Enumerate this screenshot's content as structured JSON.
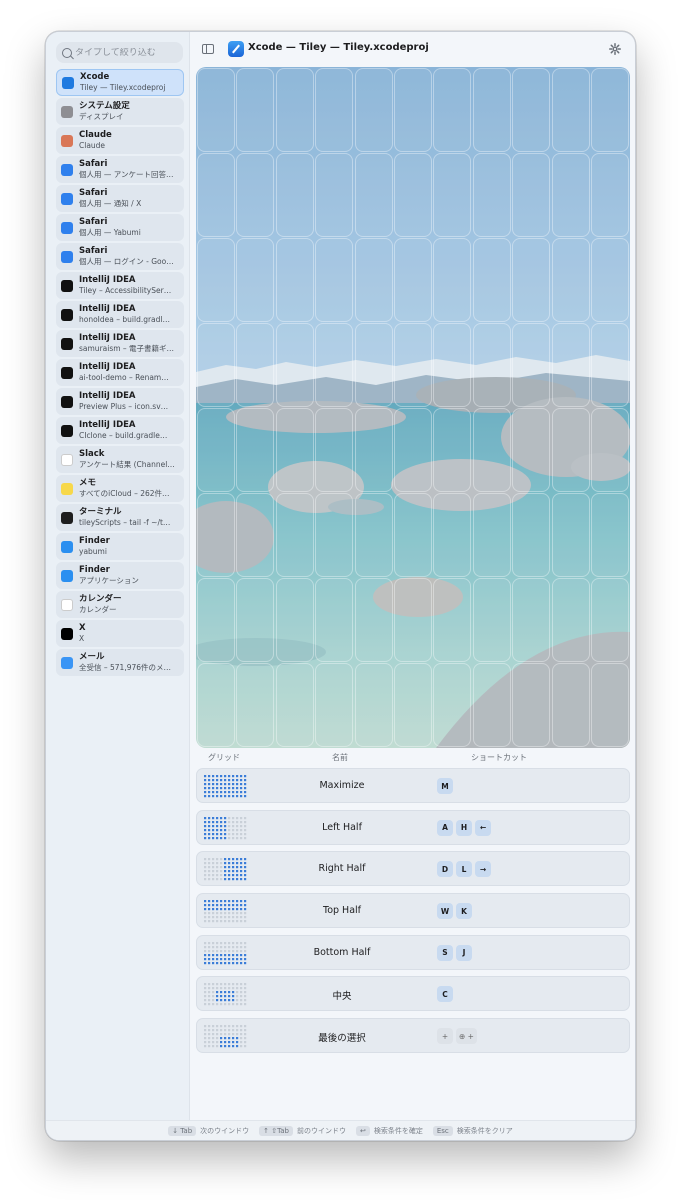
{
  "window": {
    "title": "Xcode — Tiley — Tiley.xcodeproj"
  },
  "search": {
    "placeholder": "タイプして絞り込む"
  },
  "apps": [
    {
      "name": "Xcode",
      "sub": "Tiley — Tiley.xcodeproj",
      "icon": "xcode-icon",
      "color": "#1f7ae0",
      "selected": true
    },
    {
      "name": "システム設定",
      "sub": "ディスプレイ",
      "icon": "settings-icon",
      "color": "#8e8e93"
    },
    {
      "name": "Claude",
      "sub": "Claude",
      "icon": "claude-icon",
      "color": "#d97757"
    },
    {
      "name": "Safari",
      "sub": "個人用 — アンケート回答…",
      "icon": "safari-icon",
      "color": "#2f80ed"
    },
    {
      "name": "Safari",
      "sub": "個人用 — 通知 / X",
      "icon": "safari-icon",
      "color": "#2f80ed"
    },
    {
      "name": "Safari",
      "sub": "個人用 — Yabumi",
      "icon": "safari-icon",
      "color": "#2f80ed"
    },
    {
      "name": "Safari",
      "sub": "個人用 — ログイン - Goo…",
      "icon": "safari-icon",
      "color": "#2f80ed"
    },
    {
      "name": "IntelliJ IDEA",
      "sub": "Tiley – AccessibilitySer…",
      "icon": "intellij-icon",
      "color": "#111111"
    },
    {
      "name": "IntelliJ IDEA",
      "sub": "honoIdea – build.gradl…",
      "icon": "intellij-icon",
      "color": "#111111"
    },
    {
      "name": "IntelliJ IDEA",
      "sub": "samuraism – 電子書籍ギ…",
      "icon": "intellij-icon",
      "color": "#111111"
    },
    {
      "name": "IntelliJ IDEA",
      "sub": "ai-tool-demo – Renam…",
      "icon": "intellij-icon",
      "color": "#111111"
    },
    {
      "name": "IntelliJ IDEA",
      "sub": "Preview Plus – icon.sv…",
      "icon": "intellij-icon",
      "color": "#111111"
    },
    {
      "name": "IntelliJ IDEA",
      "sub": "CIclone – build.gradle…",
      "icon": "intellij-icon",
      "color": "#111111"
    },
    {
      "name": "Slack",
      "sub": "アンケート結果 (Channel…",
      "icon": "slack-icon",
      "color": "#ffffff"
    },
    {
      "name": "メモ",
      "sub": "すべてのiCloud – 262件…",
      "icon": "notes-icon",
      "color": "#f7d84a"
    },
    {
      "name": "ターミナル",
      "sub": "tileyScripts – tail -f ~/t…",
      "icon": "terminal-icon",
      "color": "#1e1e1e"
    },
    {
      "name": "Finder",
      "sub": "yabumi",
      "icon": "finder-icon",
      "color": "#2b8ff0"
    },
    {
      "name": "Finder",
      "sub": "アプリケーション",
      "icon": "finder-icon",
      "color": "#2b8ff0"
    },
    {
      "name": "カレンダー",
      "sub": "カレンダー",
      "icon": "calendar-icon",
      "color": "#ffffff"
    },
    {
      "name": "X",
      "sub": "X",
      "icon": "x-icon",
      "color": "#000000"
    },
    {
      "name": "メール",
      "sub": "全受信 – 571,976件のメ…",
      "icon": "mail-icon",
      "color": "#3a95f5"
    }
  ],
  "columns": {
    "grid": "グリッド",
    "name": "名前",
    "shortcut": "ショートカット"
  },
  "layouts": [
    {
      "name": "Maximize",
      "keys": [
        "M"
      ],
      "cols": [
        0,
        11
      ],
      "rows": [
        0,
        6
      ]
    },
    {
      "name": "Left Half",
      "keys": [
        "A",
        "H",
        "←"
      ],
      "cols": [
        0,
        6
      ],
      "rows": [
        0,
        6
      ]
    },
    {
      "name": "Right Half",
      "keys": [
        "D",
        "L",
        "→"
      ],
      "cols": [
        5,
        11
      ],
      "rows": [
        0,
        6
      ]
    },
    {
      "name": "Top Half",
      "keys": [
        "W",
        "K"
      ],
      "cols": [
        0,
        11
      ],
      "rows": [
        0,
        3
      ]
    },
    {
      "name": "Bottom Half",
      "keys": [
        "S",
        "J"
      ],
      "cols": [
        0,
        11
      ],
      "rows": [
        3,
        6
      ]
    },
    {
      "name": "中央",
      "keys": [
        "C"
      ],
      "cols": [
        3,
        8
      ],
      "rows": [
        2,
        5
      ]
    },
    {
      "name": "最後の選択",
      "keys": [
        "+",
        "⊕ +"
      ],
      "cols": [
        4,
        9
      ],
      "rows": [
        3,
        6
      ],
      "plain_keys": true
    }
  ],
  "footer": [
    {
      "key": "↓ Tab",
      "label": "次のウインドウ"
    },
    {
      "key": "↑ ⇧Tab",
      "label": "前のウインドウ"
    },
    {
      "key": "↩",
      "label": "検索条件を確定"
    },
    {
      "key": "Esc",
      "label": "検索条件をクリア"
    }
  ],
  "colors": {
    "accent": "#1f7ae0",
    "selected_bg": "#cfe2fa",
    "dot_active": "#3b7dd8",
    "dot_inactive": "#c9d0d8"
  }
}
